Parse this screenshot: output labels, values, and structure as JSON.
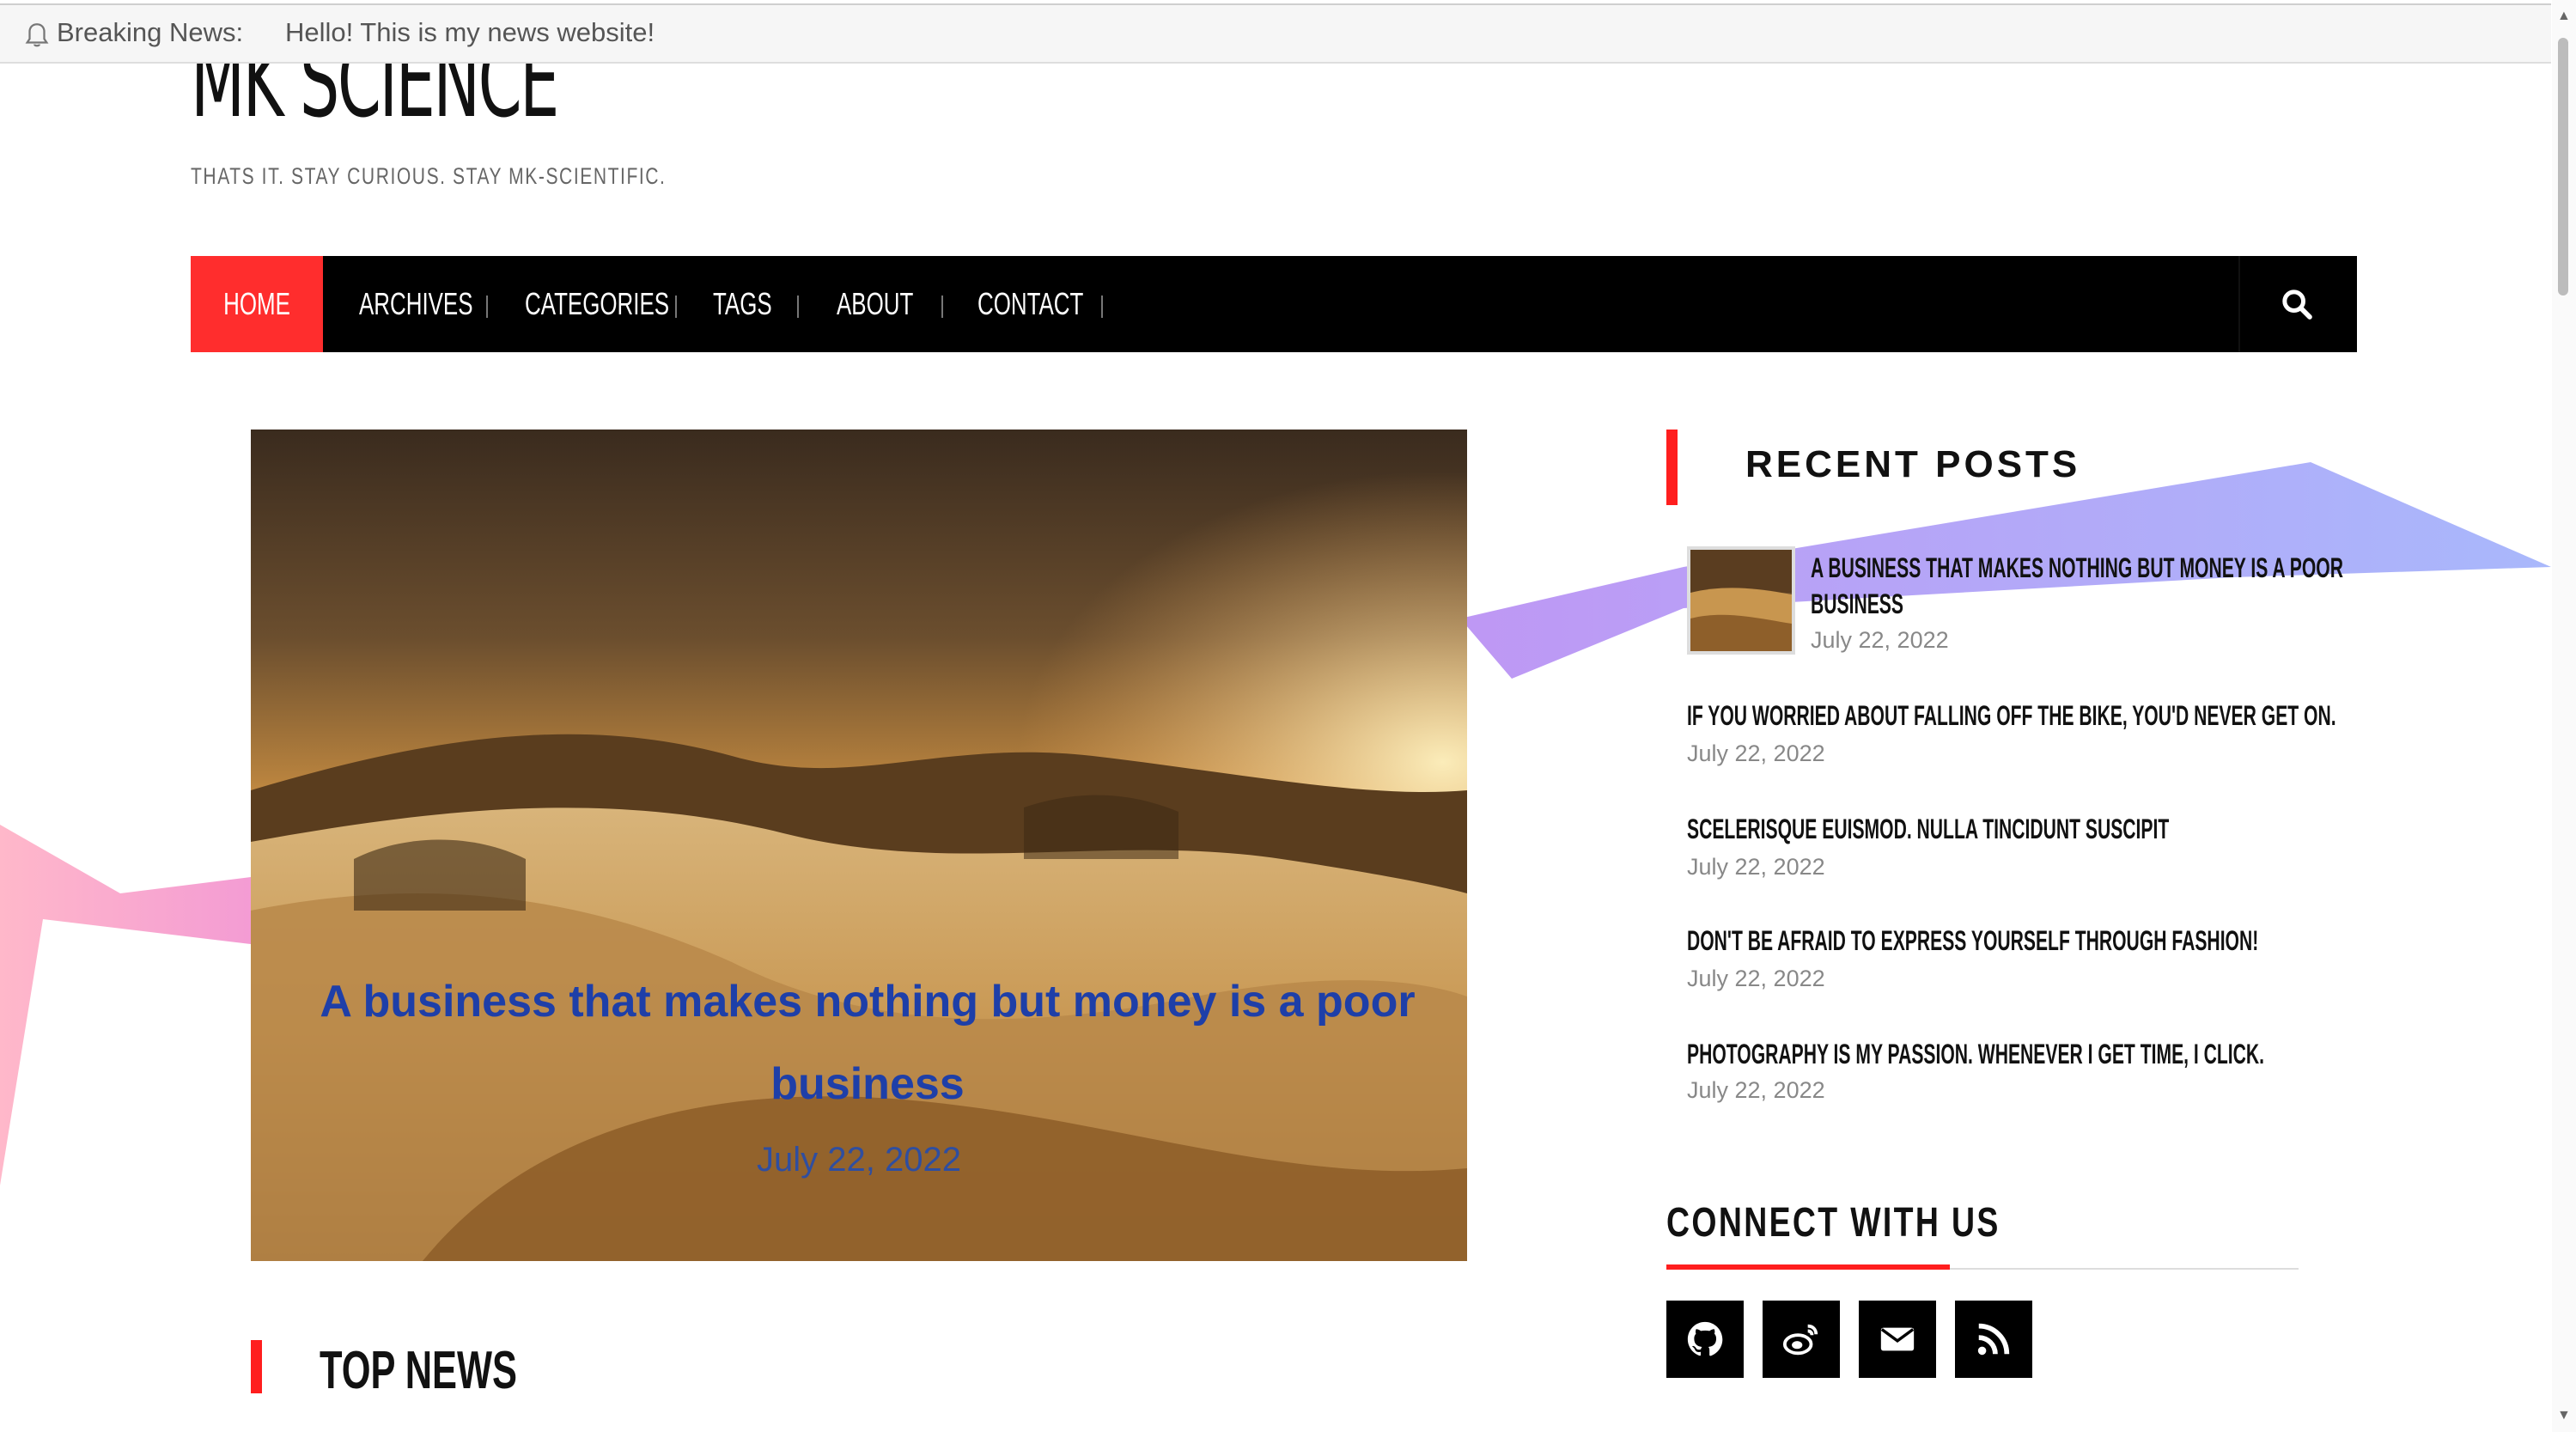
{
  "breaking": {
    "label": "Breaking News:",
    "message": "Hello! This is my news website!"
  },
  "site": {
    "title": "MK SCIENCE",
    "tagline": "THATS IT. STAY CURIOUS. STAY MK-SCIENTIFIC."
  },
  "nav": {
    "items": [
      "HOME",
      "ARCHIVES",
      "CATEGORIES",
      "TAGS",
      "ABOUT",
      "CONTACT"
    ]
  },
  "hero": {
    "title": "A business that makes nothing but money is a poor business",
    "date": "July 22, 2022"
  },
  "main": {
    "top_news_heading": "TOP NEWS"
  },
  "sidebar": {
    "recent_heading": "RECENT POSTS",
    "posts": [
      {
        "title_line1": "A BUSINESS THAT MAKES NOTHING BUT MONEY IS A POOR",
        "title_line2": "BUSINESS",
        "date": "July 22, 2022"
      },
      {
        "title": "IF YOU WORRIED ABOUT FALLING OFF THE BIKE, YOU'D NEVER GET ON.",
        "date": "July 22, 2022"
      },
      {
        "title": "SCELERISQUE EUISMOD. NULLA TINCIDUNT SUSCIPIT",
        "date": "July 22, 2022"
      },
      {
        "title": "DON'T BE AFRAID TO EXPRESS YOURSELF THROUGH FASHION!",
        "date": "July 22, 2022"
      },
      {
        "title": "PHOTOGRAPHY IS MY PASSION. WHENEVER I GET TIME, I CLICK.",
        "date": "July 22, 2022"
      }
    ],
    "connect_heading": "CONNECT WITH US",
    "social_icons": [
      "github-icon",
      "weibo-icon",
      "email-icon",
      "rss-icon"
    ]
  },
  "colors": {
    "accent": "#ff2d2d",
    "nav_bg": "#000000",
    "hero_title": "#1e3fa8"
  }
}
